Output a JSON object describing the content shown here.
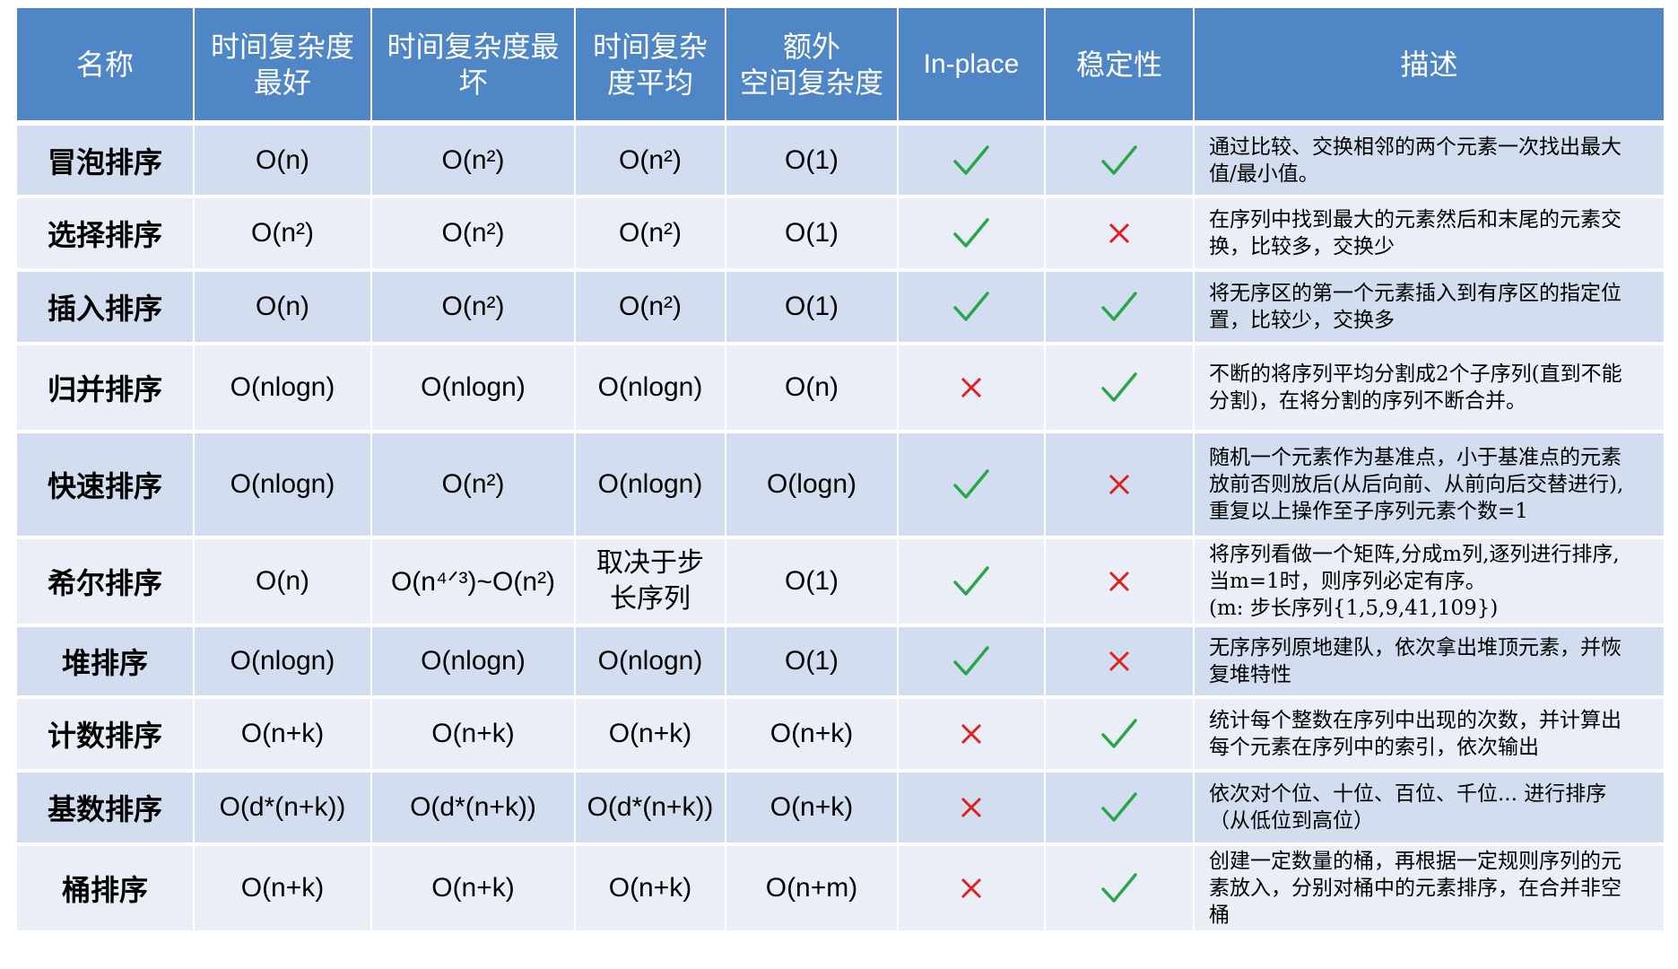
{
  "headers": {
    "name": "名称",
    "best": "时间复杂度\n最好",
    "worst": "时间复杂度最\n坏",
    "avg": "时间复杂\n度平均",
    "space": "额外\n空间复杂度",
    "inplace": "In-place",
    "stable": "稳定性",
    "desc": "描述"
  },
  "colors": {
    "header_bg": "#4f86c6",
    "row_dark": "#d2deef",
    "row_light": "#eaeff7",
    "check": "#2aa64a",
    "cross": "#e02020"
  },
  "rows": [
    {
      "name": "冒泡排序",
      "best": "O(n)",
      "worst": "O(n²)",
      "avg": "O(n²)",
      "space": "O(1)",
      "inplace": true,
      "stable": true,
      "desc": "通过比较、交换相邻的两个元素一次找出最大\n值/最小值。"
    },
    {
      "name": "选择排序",
      "best": "O(n²)",
      "worst": "O(n²)",
      "avg": "O(n²)",
      "space": "O(1)",
      "inplace": true,
      "stable": false,
      "desc": "在序列中找到最大的元素然后和末尾的元素交\n换，比较多，交换少"
    },
    {
      "name": "插入排序",
      "best": "O(n)",
      "worst": "O(n²)",
      "avg": "O(n²)",
      "space": "O(1)",
      "inplace": true,
      "stable": true,
      "desc": "将无序区的第一个元素插入到有序区的指定位\n置，比较少，交换多"
    },
    {
      "name": "归并排序",
      "best": "O(nlogn)",
      "worst": "O(nlogn)",
      "avg": "O(nlogn)",
      "space": "O(n)",
      "inplace": false,
      "stable": true,
      "desc": "不断的将序列平均分割成2个子序列(直到不能\n分割)，在将分割的序列不断合并。"
    },
    {
      "name": "快速排序",
      "best": "O(nlogn)",
      "worst": "O(n²)",
      "avg": "O(nlogn)",
      "space": "O(logn)",
      "inplace": true,
      "stable": false,
      "desc": "随机一个元素作为基准点，小于基准点的元素\n放前否则放后(从后向前、从前向后交替进行),\n重复以上操作至子序列元素个数=1"
    },
    {
      "name": "希尔排序",
      "best": "O(n)",
      "worst": "O(n⁴ᐟ³)~O(n²)",
      "avg": "取决于步\n长序列",
      "space": "O(1)",
      "inplace": true,
      "stable": false,
      "desc": "将序列看做一个矩阵,分成m列,逐列进行排序,\n当m=1时，则序列必定有序。\n (m: 步长序列{1,5,9,41,109})"
    },
    {
      "name": "堆排序",
      "best": "O(nlogn)",
      "worst": "O(nlogn)",
      "avg": "O(nlogn)",
      "space": "O(1)",
      "inplace": true,
      "stable": false,
      "desc": "无序序列原地建队，依次拿出堆顶元素，并恢\n复堆特性"
    },
    {
      "name": "计数排序",
      "best": "O(n+k)",
      "worst": "O(n+k)",
      "avg": "O(n+k)",
      "space": "O(n+k)",
      "inplace": false,
      "stable": true,
      "desc": "统计每个整数在序列中出现的次数，并计算出\n每个元素在序列中的索引，依次输出"
    },
    {
      "name": "基数排序",
      "best": "O(d*(n+k))",
      "worst": "O(d*(n+k))",
      "avg": "O(d*(n+k))",
      "space": "O(n+k)",
      "inplace": false,
      "stable": true,
      "desc": "依次对个位、十位、百位、千位... 进行排序\n（从低位到高位）"
    },
    {
      "name": "桶排序",
      "best": "O(n+k)",
      "worst": "O(n+k)",
      "avg": "O(n+k)",
      "space": "O(n+m)",
      "inplace": false,
      "stable": true,
      "desc": "创建一定数量的桶，再根据一定规则序列的元\n素放入，分别对桶中的元素排序，在合并非空\n桶"
    }
  ]
}
